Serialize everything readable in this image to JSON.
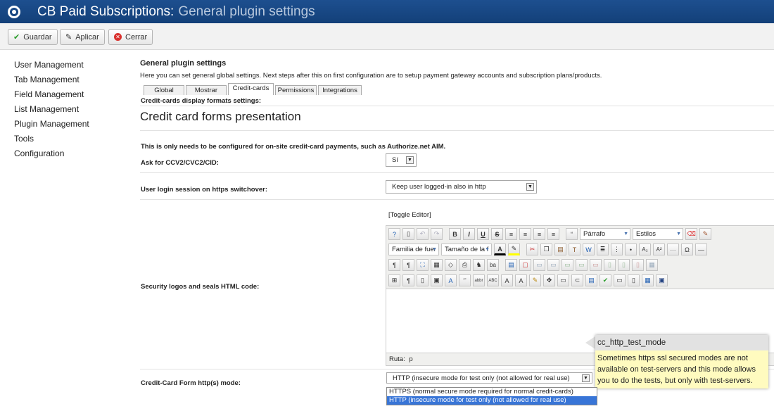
{
  "header": {
    "title_main": "CB Paid Subscriptions:",
    "title_sub": "General plugin settings"
  },
  "toolbar": {
    "save_label": "Guardar",
    "apply_label": "Aplicar",
    "close_label": "Cerrar"
  },
  "sidebar": {
    "items": [
      {
        "label": "User Management"
      },
      {
        "label": "Tab Management"
      },
      {
        "label": "Field Management"
      },
      {
        "label": "List Management"
      },
      {
        "label": "Plugin Management"
      },
      {
        "label": "Tools"
      },
      {
        "label": "Configuration"
      }
    ]
  },
  "main": {
    "section_title": "General plugin settings",
    "section_desc": "Here you can set general global settings. Next steps after this on first configuration are to setup payment gateway accounts and subscription plans/products.",
    "tabs": [
      {
        "label": "Global"
      },
      {
        "label": "Mostrar"
      },
      {
        "label": "Credit-cards"
      },
      {
        "label": "Permissions"
      },
      {
        "label": "Integrations"
      }
    ],
    "panel_heading": "Credit-cards display formats settings:",
    "big_title": "Credit card forms presentation",
    "onsite_note": "This is only needs to be configured for on-site credit-card payments, such as Authorize.net AIM.",
    "ccv_label": "Ask for CCV2/CVC2/CID:",
    "ccv_value": "Sí",
    "session_label": "User login session on https switchover:",
    "session_value": "Keep user logged-in also in http",
    "security_label": "Security logos and seals HTML code:",
    "toggle_editor": "[Toggle Editor]",
    "ruta_label": "Ruta:",
    "ruta_value": "p",
    "http_label": "Credit-Card Form http(s) mode:",
    "http_value": "HTTP (insecure mode for test only (not allowed for real use)",
    "http_options": [
      "HTTPS (normal secure mode required for normal credit-cards)",
      "HTTP (insecure mode for test only (not allowed for real use)"
    ]
  },
  "editor": {
    "format_select": "Párrafo",
    "styles_select": "Estilos",
    "font_family_select": "Familia de fuer",
    "font_size_select": "Tamaño de la f"
  },
  "tooltip": {
    "title": "cc_http_test_mode",
    "body": "Sometimes https ssl secured modes are not available on test-servers and this mode allows you to do the tests, but only with test-servers."
  },
  "colors": {
    "header_bg": "#1d4f8f",
    "tooltip_bg": "#fffbbf",
    "selected_option": "#3875d7",
    "save_icon": "#2a9d2a",
    "close_icon": "#d9302c"
  }
}
